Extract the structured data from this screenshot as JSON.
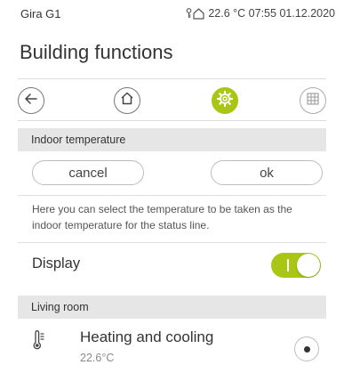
{
  "status_bar": {
    "device_name": "Gira G1",
    "temperature": "22.6 °C",
    "time": "07:55",
    "date": "01.12.2020",
    "icon": "key-house-icon"
  },
  "page_title": "Building functions",
  "nav": {
    "buttons": [
      {
        "name": "back-arrow-icon",
        "active": false
      },
      {
        "name": "home-icon",
        "active": false
      },
      {
        "name": "gear-icon",
        "active": true
      },
      {
        "name": "grid-icon",
        "active": false
      }
    ],
    "accent_color": "#a9c614"
  },
  "indoor_temperature": {
    "header": "Indoor temperature",
    "cancel_label": "cancel",
    "ok_label": "ok",
    "description": "Here you can select the temperature to be taken as the indoor temperature for the status line."
  },
  "display": {
    "label": "Display",
    "toggle_on": true
  },
  "living_room": {
    "header": "Living room",
    "item_title": "Heating and cooling",
    "item_value": "22.6°C",
    "item_icon": "thermometer-icon",
    "selected": true
  }
}
